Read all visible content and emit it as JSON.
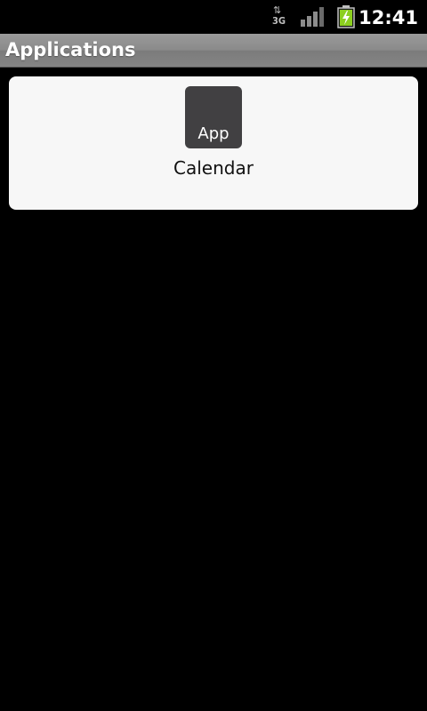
{
  "status_bar": {
    "network_type": "3G",
    "network_activity_icon": "up-down-arrows-icon",
    "signal_icon": "cell-signal-icon",
    "battery_icon": "battery-charging-icon",
    "time": "12:41"
  },
  "title_bar": {
    "title": "Applications"
  },
  "apps": [
    {
      "icon_label": "App",
      "name": "Calendar"
    }
  ],
  "colors": {
    "background": "#000000",
    "title_bar": "#8a8a8a",
    "panel": "#f7f7f7",
    "app_icon": "#414042",
    "battery_charge": "#8ccf1f"
  }
}
